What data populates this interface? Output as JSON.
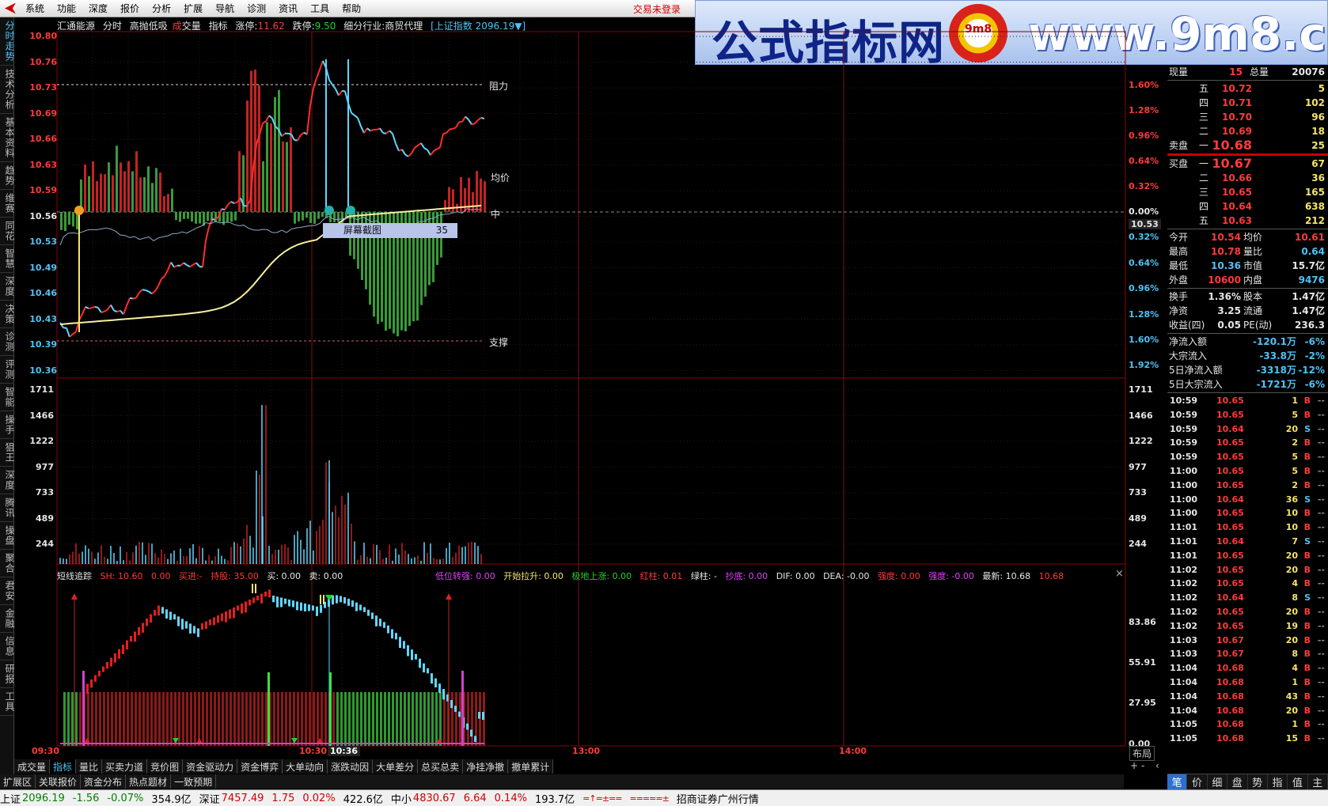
{
  "menu": [
    "系统",
    "功能",
    "深度",
    "报价",
    "分析",
    "扩展",
    "导航",
    "诊测",
    "资讯",
    "工具",
    "帮助"
  ],
  "trade_status": "交易未登录",
  "banner": {
    "cn": "公式指标网",
    "seal": "9m8",
    "url": "www.9m8.cn"
  },
  "left_tabs": [
    "分时走势",
    "技术分析",
    "基本资料",
    "趋势",
    "维赛",
    "同花",
    "智慧",
    "深度",
    "决策",
    "诊测",
    "评测",
    "智能",
    "操手",
    "狙王",
    "深度",
    "腾讯",
    "操盘",
    "聚合",
    "君安",
    "金融",
    "信息",
    "研报",
    "工具"
  ],
  "chart_header": {
    "stock": "汇通能源",
    "mode": "分时",
    "strategy": "高抛低吸",
    "vol1": "成",
    "vol2": "交量",
    "ind": "指标",
    "up_label": "涨停:",
    "up_val": "11.62",
    "dn_label": "跌停:",
    "dn_val": "9.50",
    "industry": "细分行业:商贸代理",
    "index": "[上证指数 2096.19▼]"
  },
  "price_axis": [
    "10.80",
    "10.76",
    "10.73",
    "10.69",
    "10.66",
    "10.63",
    "10.59",
    "10.56",
    "10.53",
    "10.49",
    "10.46",
    "10.43",
    "10.39",
    "10.36"
  ],
  "pct_axis_up": [
    "1.60%",
    "1.28%",
    "0.96%",
    "0.64%",
    "0.32%",
    "0.00%"
  ],
  "pct_axis_dn": [
    "0.32%",
    "0.64%",
    "0.96%",
    "1.28%",
    "1.60%",
    "1.92%"
  ],
  "cur_price_tag": "10.53",
  "tags": {
    "resist": "阻力",
    "avg": "均价",
    "mid": "中",
    "support": "支撑"
  },
  "tooltip": {
    "label": "屏幕截图",
    "num": "35"
  },
  "vol_axis": [
    "1711",
    "1466",
    "1222",
    "977",
    "733",
    "489",
    "244"
  ],
  "indicator": {
    "name": "短线追踪",
    "b1": "SH: 10.60",
    "b2": "0.00",
    "buyin": "买进:-",
    "hold": "持股: 35.00",
    "buy": "买: 0.00",
    "sell": "卖: 0.00",
    "r1": "低位转强: 0.00",
    "r2": "开始拉升: 0.00",
    "r3": "极地上涨: 0.00",
    "r4": "红柱: 0.01",
    "r5": "绿柱: -",
    "r6": "抄底: 0.00",
    "r7": "DIF: 0.00",
    "r8": "DEA: -0.00",
    "r9": "强度: 0.00",
    "r10": "强度: -0.00",
    "r11": "最新: 10.68",
    "r12": "10.68",
    "axis": [
      "83.86",
      "55.91",
      "27.95",
      "0.00"
    ]
  },
  "time_axis": [
    "09:30",
    "10:30",
    "10:36",
    "13:00",
    "14:00"
  ],
  "layout_btn": "布局",
  "bottom_tabs": [
    "成交量",
    "指标",
    "量比",
    "买卖力道",
    "竞价图",
    "资金驱动力",
    "资金博弈",
    "大单动向",
    "涨跌动因",
    "大单差分",
    "总买总卖",
    "净挂净撤",
    "撤单累计"
  ],
  "bottom_tabs2": [
    "扩展区",
    "关联报价",
    "资金分布",
    "热点题材",
    "一致预期"
  ],
  "status": {
    "sh_name": "上证",
    "sh_val": "2096.19",
    "sh_chg": "-1.56",
    "sh_pct": "-0.07%",
    "sh_amt": "354.9亿",
    "sz_name": "深证",
    "sz_val": "7457.49",
    "sz_chg": "1.75",
    "sz_pct": "0.02%",
    "sz_amt": "422.6亿",
    "zx_name": "中小",
    "zx_val": "4830.67",
    "zx_chg": "6.64",
    "zx_pct": "0.14%",
    "zx_amt": "193.7亿",
    "broker": "招商证券广州行情"
  },
  "quote": {
    "xianliang_l": "现量",
    "xianliang": "15",
    "zongliang_l": "总量",
    "zongliang": "20076",
    "sell_label": "卖盘",
    "buy_label": "买盘",
    "asks": [
      {
        "lvl": "五",
        "p": "10.72",
        "v": "5"
      },
      {
        "lvl": "四",
        "p": "10.71",
        "v": "102"
      },
      {
        "lvl": "三",
        "p": "10.70",
        "v": "96"
      },
      {
        "lvl": "二",
        "p": "10.69",
        "v": "18"
      },
      {
        "lvl": "一",
        "p": "10.68",
        "v": "25"
      }
    ],
    "bids": [
      {
        "lvl": "一",
        "p": "10.67",
        "v": "67"
      },
      {
        "lvl": "二",
        "p": "10.66",
        "v": "36"
      },
      {
        "lvl": "三",
        "p": "10.65",
        "v": "165"
      },
      {
        "lvl": "四",
        "p": "10.64",
        "v": "638"
      },
      {
        "lvl": "五",
        "p": "10.63",
        "v": "212"
      }
    ],
    "stats": [
      {
        "l1": "今开",
        "v1": "10.54",
        "l2": "均价",
        "v2": "10.61",
        "c1": "#ff3b3b",
        "c2": "#ff3b3b"
      },
      {
        "l1": "最高",
        "v1": "10.78",
        "l2": "量比",
        "v2": "0.64",
        "c1": "#ff3b3b",
        "c2": "#4fc3f7"
      },
      {
        "l1": "最低",
        "v1": "10.36",
        "l2": "市值",
        "v2": "15.7亿",
        "c1": "#4fc3f7",
        "c2": "#e6e6e6"
      },
      {
        "l1": "外盘",
        "v1": "10600",
        "l2": "内盘",
        "v2": "9476",
        "c1": "#ff3b3b",
        "c2": "#4fc3f7"
      }
    ],
    "stats2": [
      {
        "l1": "换手",
        "v1": "1.36%",
        "l2": "股本",
        "v2": "1.47亿"
      },
      {
        "l1": "净资",
        "v1": "3.25",
        "l2": "流通",
        "v2": "1.47亿"
      },
      {
        "l1": "收益(四)",
        "v1": "0.05",
        "l2": "PE(动)",
        "v2": "236.3"
      }
    ],
    "flows": [
      {
        "l": "净流入额",
        "v": "-120.1万",
        "p": "-6%"
      },
      {
        "l": "大宗流入",
        "v": "-33.8万",
        "p": "-2%"
      },
      {
        "l": "5日净流入额",
        "v": "-3318万",
        "p": "-12%"
      },
      {
        "l": "5日大宗流入",
        "v": "-1721万",
        "p": "-6%"
      }
    ]
  },
  "ticks": [
    {
      "t": "10:59",
      "p": "10.65",
      "v": "1",
      "d": "B",
      "x": "--"
    },
    {
      "t": "10:59",
      "p": "10.65",
      "v": "5",
      "d": "B",
      "x": "--"
    },
    {
      "t": "10:59",
      "p": "10.64",
      "v": "20",
      "d": "S",
      "x": "--"
    },
    {
      "t": "10:59",
      "p": "10.65",
      "v": "2",
      "d": "B",
      "x": "--"
    },
    {
      "t": "10:59",
      "p": "10.65",
      "v": "5",
      "d": "B",
      "x": "--"
    },
    {
      "t": "11:00",
      "p": "10.65",
      "v": "5",
      "d": "B",
      "x": "--"
    },
    {
      "t": "11:00",
      "p": "10.65",
      "v": "2",
      "d": "B",
      "x": "--"
    },
    {
      "t": "11:00",
      "p": "10.64",
      "v": "36",
      "d": "S",
      "x": "--"
    },
    {
      "t": "11:00",
      "p": "10.65",
      "v": "10",
      "d": "B",
      "x": "--"
    },
    {
      "t": "11:01",
      "p": "10.65",
      "v": "10",
      "d": "B",
      "x": "--"
    },
    {
      "t": "11:01",
      "p": "10.64",
      "v": "7",
      "d": "S",
      "x": "--"
    },
    {
      "t": "11:01",
      "p": "10.65",
      "v": "20",
      "d": "B",
      "x": "--"
    },
    {
      "t": "11:02",
      "p": "10.65",
      "v": "20",
      "d": "B",
      "x": "--"
    },
    {
      "t": "11:02",
      "p": "10.65",
      "v": "4",
      "d": "B",
      "x": "--"
    },
    {
      "t": "11:02",
      "p": "10.64",
      "v": "8",
      "d": "S",
      "x": "--"
    },
    {
      "t": "11:02",
      "p": "10.65",
      "v": "20",
      "d": "B",
      "x": "--"
    },
    {
      "t": "11:02",
      "p": "10.65",
      "v": "19",
      "d": "B",
      "x": "--"
    },
    {
      "t": "11:03",
      "p": "10.67",
      "v": "20",
      "d": "B",
      "x": "--"
    },
    {
      "t": "11:03",
      "p": "10.67",
      "v": "8",
      "d": "B",
      "x": "--"
    },
    {
      "t": "11:04",
      "p": "10.68",
      "v": "4",
      "d": "B",
      "x": "--"
    },
    {
      "t": "11:04",
      "p": "10.68",
      "v": "1",
      "d": "B",
      "x": "--"
    },
    {
      "t": "11:04",
      "p": "10.68",
      "v": "43",
      "d": "B",
      "x": "--"
    },
    {
      "t": "11:04",
      "p": "10.68",
      "v": "20",
      "d": "B",
      "x": "--"
    },
    {
      "t": "11:05",
      "p": "10.68",
      "v": "1",
      "d": "B",
      "x": "--"
    },
    {
      "t": "11:05",
      "p": "10.68",
      "v": "15",
      "d": "B",
      "x": "--"
    }
  ],
  "rp_tabs": [
    "笔",
    "价",
    "细",
    "盘",
    "势",
    "指",
    "值",
    "主"
  ]
}
